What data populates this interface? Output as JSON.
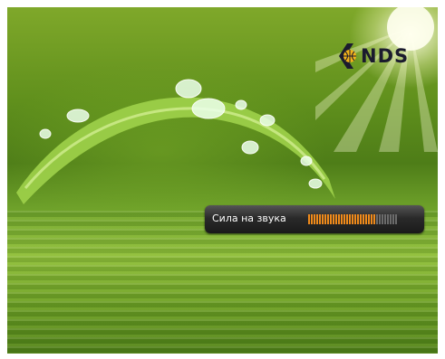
{
  "logo": {
    "text": "NDS"
  },
  "volume_osd": {
    "label": "Сила на звука",
    "level_fraction": 0.76,
    "segments_total": 33,
    "active_color": "#f08a1a",
    "inactive_color": "#6b6b6b"
  }
}
